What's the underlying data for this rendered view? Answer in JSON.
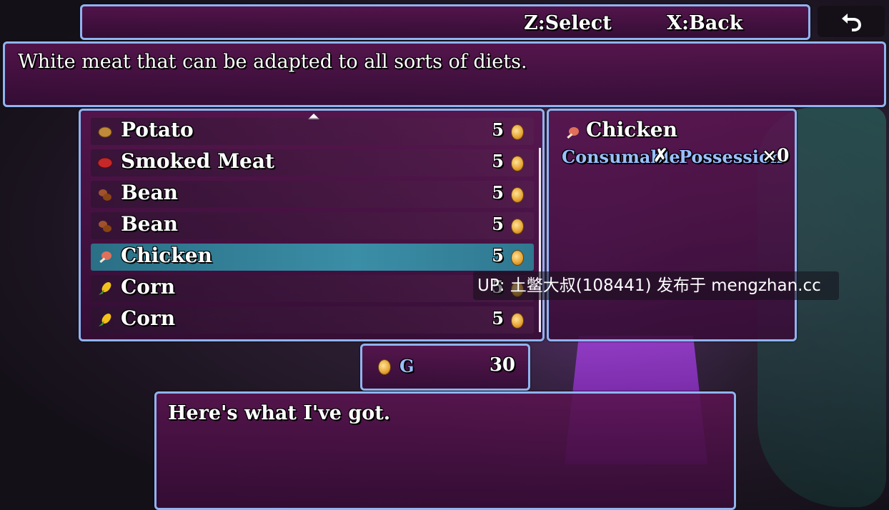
{
  "keyhelp": {
    "select": "Z:Select",
    "back": "X:Back"
  },
  "help": {
    "text": "White meat that can be adapted to all sorts of diets."
  },
  "shop_items": [
    {
      "name": "Potato",
      "price": "5",
      "icon": "potato-icon"
    },
    {
      "name": "Smoked Meat",
      "price": "5",
      "icon": "meat-icon"
    },
    {
      "name": "Bean",
      "price": "5",
      "icon": "bean-icon"
    },
    {
      "name": "Bean",
      "price": "5",
      "icon": "bean-icon"
    },
    {
      "name": "Chicken",
      "price": "5",
      "icon": "chicken-icon",
      "selected": true
    },
    {
      "name": "Corn",
      "price": "5",
      "icon": "corn-icon"
    },
    {
      "name": "Corn",
      "price": "5",
      "icon": "corn-icon"
    }
  ],
  "status": {
    "item_name": "Chicken",
    "consumable_label": "Consumable",
    "consumable_value": "✗",
    "possession_label": "Possession",
    "possession_value": "×0"
  },
  "gold": {
    "unit": "G",
    "amount": "30"
  },
  "message": {
    "text": "Here's what I've got."
  },
  "watermark": "UP: 土鳖大叔(108441) 发布于 mengzhan.cc",
  "colors": {
    "window_border": "#8fb4f0",
    "selection": "#3a8ea6",
    "label": "#9ac0ff"
  }
}
